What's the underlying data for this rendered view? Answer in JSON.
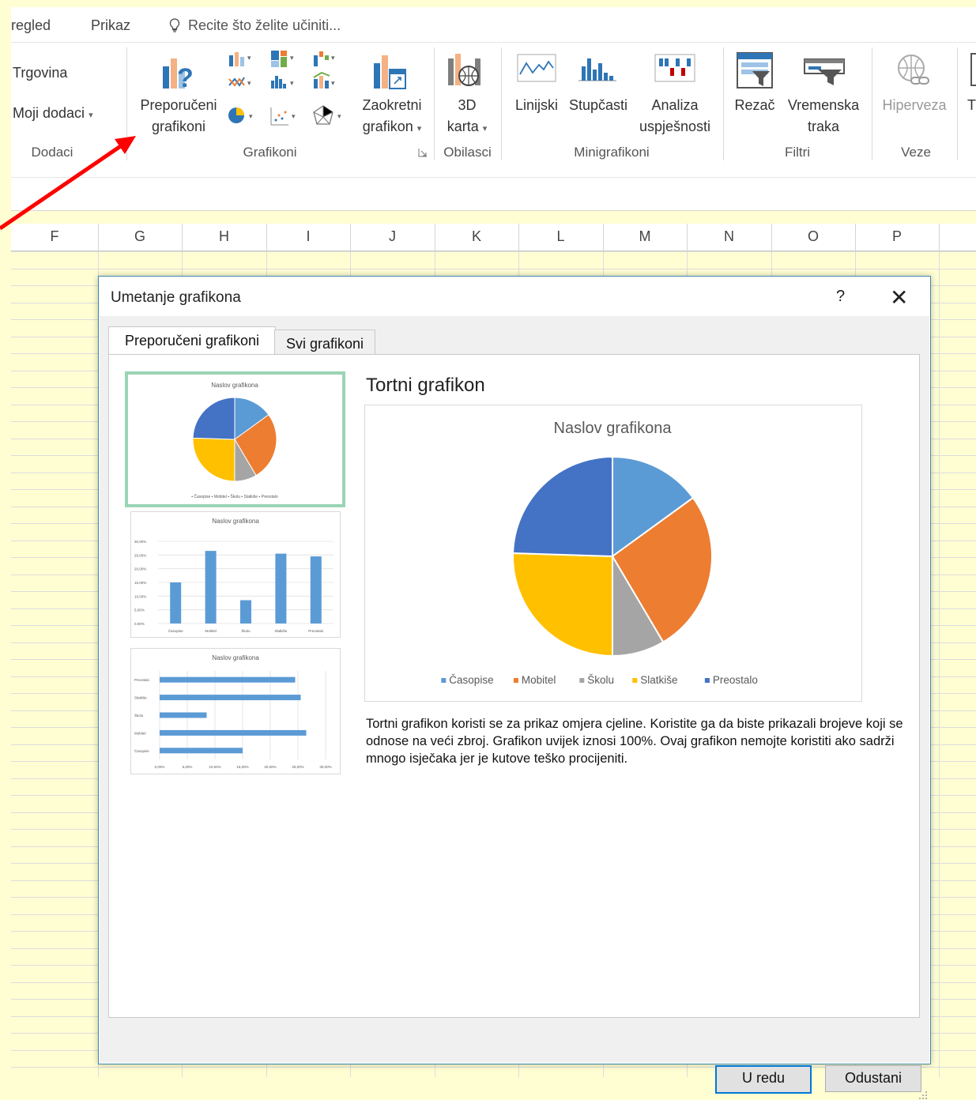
{
  "ribbon_tabs": [
    "regled",
    "Prikaz"
  ],
  "tell_me": "Recite što želite učiniti...",
  "ribbon": {
    "addins_items": [
      "Trgovina",
      "Moji dodaci"
    ],
    "addins_label": "Dodaci",
    "recommended_label_1": "Preporučeni",
    "recommended_label_2": "grafikoni",
    "pivot_label_1": "Zaokretni",
    "pivot_label_2": "grafikon",
    "charts_label": "Grafikoni",
    "map3d_label_1": "3D",
    "map3d_label_2": "karta",
    "tours_label": "Obilasci",
    "sparkline_line": "Linijski",
    "sparkline_column": "Stupčasti",
    "sparkline_winloss_1": "Analiza",
    "sparkline_winloss_2": "uspješnosti",
    "sparklines_label": "Minigrafikoni",
    "slicer": "Rezač",
    "timeline_1": "Vremenska",
    "timeline_2": "traka",
    "filters_label": "Filtri",
    "hyperlink": "Hiperveza",
    "links_label": "Veze",
    "cut_text": "T"
  },
  "columns": [
    "F",
    "G",
    "H",
    "I",
    "J",
    "K",
    "L",
    "M",
    "N",
    "O",
    "P"
  ],
  "dialog": {
    "title": "Umetanje grafikona",
    "help": "?",
    "close": "✕",
    "tabs": [
      "Preporučeni grafikoni",
      "Svi grafikoni"
    ],
    "selected_chart_name": "Tortni grafikon",
    "description": "Tortni grafikon koristi se za prikaz omjera cjeline. Koristite ga da biste prikazali brojeve koji se odnose na veći zbroj. Grafikon uvijek iznosi 100%. Ovaj grafikon nemojte koristiti ako sadrži mnogo isječaka jer je kutove teško procijeniti.",
    "ok": "U redu",
    "cancel": "Odustani"
  },
  "colors": {
    "accent": "#0078d7",
    "selection": "#9ad4b6",
    "arrow": "#ff0000"
  },
  "chart_data": [
    {
      "type": "pie",
      "title": "Naslov grafikona",
      "categories": [
        "Časopise",
        "Mobitel",
        "Školu",
        "Slatkiše",
        "Preostalo"
      ],
      "values": [
        15,
        26.5,
        8.5,
        25.5,
        24.5
      ],
      "colors": [
        "#5b9bd5",
        "#ed7d31",
        "#a5a5a5",
        "#ffc000",
        "#4472c4"
      ],
      "legend": "bottom"
    },
    {
      "type": "bar",
      "title": "Naslov grafikona",
      "categories": [
        "Časopise",
        "Mobitel",
        "Školu",
        "Slatkiše",
        "Preostalo"
      ],
      "values": [
        15,
        26.5,
        8.5,
        25.5,
        24.5
      ],
      "ylim": [
        0,
        30
      ],
      "yticks": [
        "0,00%",
        "5,00%",
        "10,00%",
        "15,00%",
        "20,00%",
        "25,00%",
        "30,00%"
      ]
    },
    {
      "type": "bar-horizontal",
      "title": "Naslov grafikona",
      "categories": [
        "Časopise",
        "Mobitel",
        "Školu",
        "Slatkiše",
        "Preostalo"
      ],
      "values": [
        15,
        26.5,
        8.5,
        25.5,
        24.5
      ],
      "xlim": [
        0,
        30
      ],
      "xticks": [
        "0,00%",
        "5,00%",
        "10,00%",
        "15,00%",
        "20,00%",
        "25,00%",
        "30,00%"
      ]
    }
  ]
}
